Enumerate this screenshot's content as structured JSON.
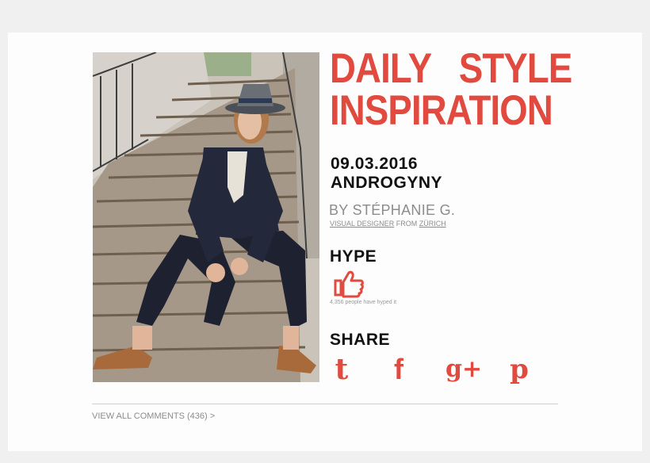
{
  "header": {
    "title_line1": "DAILY   STYLE",
    "title_line2": "INSPIRATION"
  },
  "post": {
    "date": "09.03.2016",
    "topic": "ANDROGYNY",
    "author": "BY STÉPHANIE G.",
    "role_link": "VISUAL DESIGNER",
    "role_from": " FROM ",
    "location_link": "ZÜRICH"
  },
  "hype": {
    "label": "HYPE",
    "count_text": "4,356 people have hyped it",
    "icon": "thumbs-up-icon"
  },
  "share": {
    "label": "SHARE",
    "tumblr": "t",
    "facebook": "f",
    "googleplus": "g+",
    "pinterest": "p"
  },
  "comments": {
    "link_text": "VIEW ALL COMMENTS (436) >"
  },
  "colors": {
    "accent": "#e04a3f",
    "text": "#111111",
    "muted": "#8c8c8c"
  }
}
